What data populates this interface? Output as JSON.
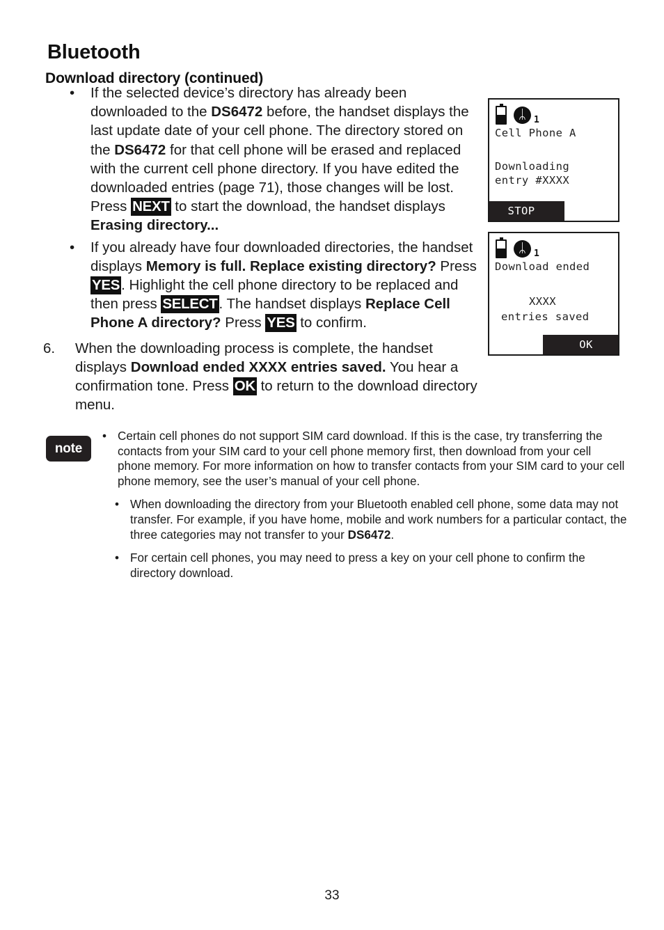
{
  "document": {
    "chapter_title": "Bluetooth",
    "section_title": "Download directory (continued)",
    "page_number": "33"
  },
  "main_content": {
    "bullets": [
      {
        "marker": "•",
        "segments": [
          {
            "text": "If the selected device’s directory has already been downloaded to the ",
            "style": "normal"
          },
          {
            "text": "DS6472",
            "style": "bold"
          },
          {
            "text": " before, the handset displays the last update date of your cell phone. The directory stored on the ",
            "style": "normal"
          },
          {
            "text": "DS6472",
            "style": "bold"
          },
          {
            "text": " for that cell phone will be erased and replaced with the current cell phone directory. If you have edited the downloaded entries (page 71), those changes will be lost. Press ",
            "style": "normal"
          },
          {
            "text": "NEXT",
            "style": "keycap"
          },
          {
            "text": " to start the download, the handset displays ",
            "style": "normal"
          },
          {
            "text": "Erasing directory...",
            "style": "bold"
          }
        ]
      },
      {
        "marker": "•",
        "segments": [
          {
            "text": "If you already have four downloaded directories, the handset displays ",
            "style": "normal"
          },
          {
            "text": "Memory is full. Replace existing directory?",
            "style": "bold"
          },
          {
            "text": " Press ",
            "style": "normal"
          },
          {
            "text": "YES",
            "style": "keycap"
          },
          {
            "text": ". Highlight the cell phone directory to be replaced and then press ",
            "style": "normal"
          },
          {
            "text": "SELECT",
            "style": "keycap"
          },
          {
            "text": ". The handset displays ",
            "style": "normal"
          },
          {
            "text": "Replace Cell Phone A directory?",
            "style": "bold"
          },
          {
            "text": " Press ",
            "style": "normal"
          },
          {
            "text": "YES",
            "style": "keycap"
          },
          {
            "text": " to confirm.",
            "style": "normal"
          }
        ]
      }
    ],
    "numbered_step": {
      "marker": "6.",
      "segments": [
        {
          "text": "When the downloading process is complete, the handset displays ",
          "style": "normal"
        },
        {
          "text": "Download ended XXXX entries saved.",
          "style": "bold"
        },
        {
          "text": " You hear a confirmation tone. Press ",
          "style": "normal"
        },
        {
          "text": "OK",
          "style": "keycap"
        },
        {
          "text": " to return to the download directory menu.",
          "style": "normal"
        }
      ]
    }
  },
  "note_block": {
    "badge_label": "note",
    "items": [
      {
        "marker": "•",
        "indented": false,
        "segments": [
          {
            "text": "Certain cell phones do not support SIM card download. If this is the case, try transferring the contacts from your SIM card to your cell phone memory first, then download from your cell phone memory. For more information on how to transfer contacts from your SIM card to your cell phone memory, see the user’s manual of your cell phone.",
            "style": "normal"
          }
        ]
      },
      {
        "marker": "•",
        "indented": true,
        "segments": [
          {
            "text": "When downloading the directory from your Bluetooth enabled cell phone, some data may not transfer. For example, if you have home, mobile and work numbers for a particular contact, the three categories may not transfer to your ",
            "style": "normal"
          },
          {
            "text": "DS6472",
            "style": "bold"
          },
          {
            "text": ".",
            "style": "normal"
          }
        ]
      },
      {
        "marker": "•",
        "indented": true,
        "segments": [
          {
            "text": "For certain cell phones, you may need to press a key on your cell phone to confirm the directory download.",
            "style": "normal"
          }
        ]
      }
    ]
  },
  "lcd_screens": [
    {
      "id": "downloading",
      "status": {
        "battery_icon": "battery-icon",
        "bluetooth_icon": "bluetooth-icon",
        "bluetooth_glyph": "ᛦ",
        "device_number": "1"
      },
      "title_line": "Cell Phone A",
      "body_lines": [
        "Downloading",
        "entry #XXXX"
      ],
      "softkey": {
        "label": "STOP",
        "position": "left"
      }
    },
    {
      "id": "download-ended",
      "status": {
        "battery_icon": "battery-icon",
        "bluetooth_icon": "bluetooth-icon",
        "bluetooth_glyph": "ᛦ",
        "device_number": "1"
      },
      "title_line": "Download ended",
      "body_lines": [
        "XXXX",
        "entries saved"
      ],
      "softkey": {
        "label": "OK",
        "position": "right"
      }
    }
  ],
  "colors": {
    "text": "#1a1a1a",
    "inverse_bg": "#101010",
    "inverse_fg": "#ffffff",
    "badge_bg": "#231f20",
    "page_bg": "#ffffff"
  }
}
